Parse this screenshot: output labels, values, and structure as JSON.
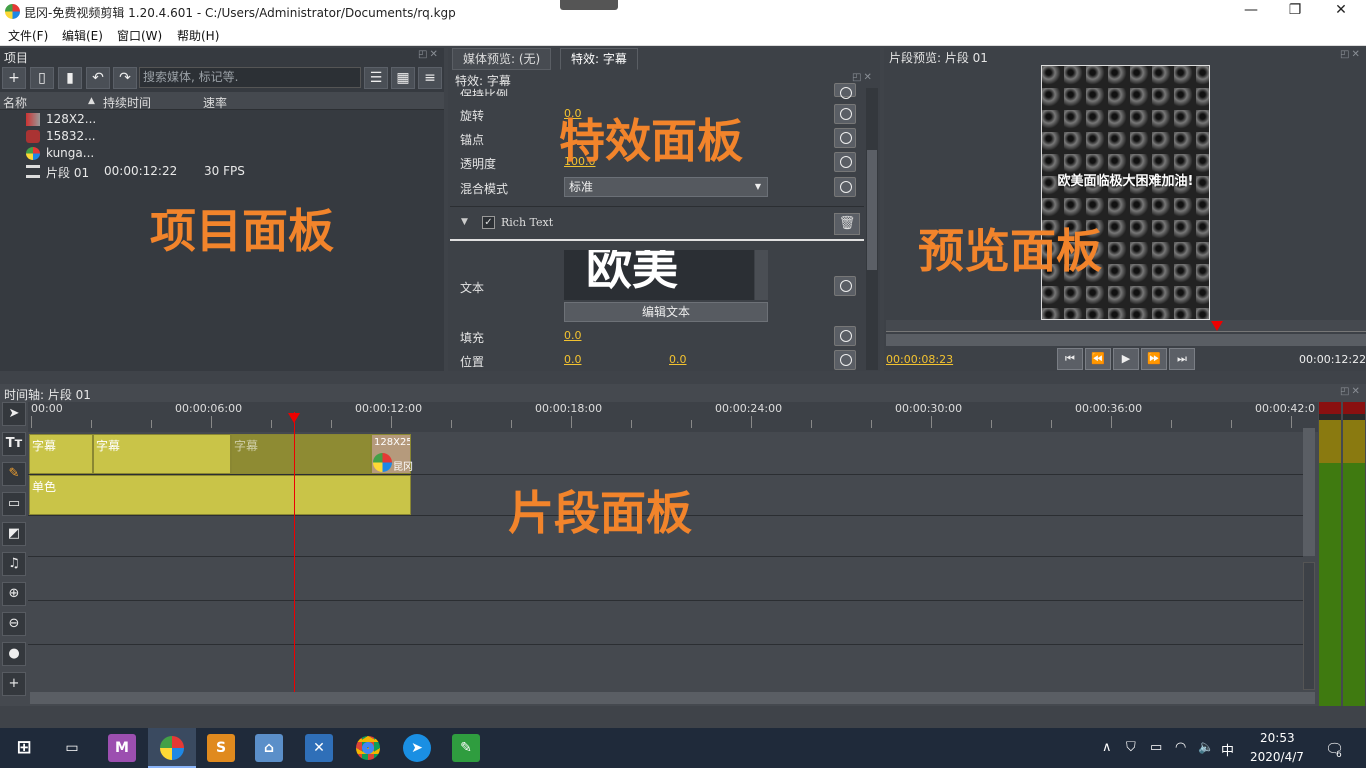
{
  "window": {
    "title": "昆冈-免费视频剪辑 1.20.4.601 - C:/Users/Administrator/Documents/rq.kgp",
    "min": "—",
    "max": "❐",
    "close": "✕"
  },
  "menu": [
    "文件(F)",
    "编辑(E)",
    "窗口(W)",
    "帮助(H)"
  ],
  "project": {
    "title": "项目",
    "search_placeholder": "搜索媒体, 标记等.",
    "columns": [
      "名称",
      "持续时间",
      "速率"
    ],
    "rows": [
      {
        "name": "128X2...",
        "duration": "",
        "rate": ""
      },
      {
        "name": "15832...",
        "duration": "",
        "rate": ""
      },
      {
        "name": "kunga...",
        "duration": "",
        "rate": ""
      },
      {
        "name": "片段 01",
        "duration": "00:00:12:22",
        "rate": "30 FPS"
      }
    ],
    "overlay": "项目面板"
  },
  "fx": {
    "tab_media": "媒体预览: (无)",
    "tab_fx": "特效: 字幕",
    "header": "特效: 字幕",
    "overlay": "特效面板",
    "rows": {
      "keep_ratio": "保持比例",
      "rotate": "旋转",
      "rotate_val": "0.0",
      "anchor": "锚点",
      "opacity": "透明度",
      "opacity_val": "100.0",
      "blend": "混合模式",
      "blend_val": "标准",
      "rich_text": "Rich Text",
      "text": "文本",
      "text_preview": "欧美",
      "edit_text": "编辑文本",
      "fill": "填充",
      "fill_val": "0.0",
      "position": "位置",
      "pos_x": "0.0",
      "pos_y": "0.0"
    }
  },
  "preview": {
    "title": "片段预览: 片段 01",
    "caption": "欧美面临极大困难加油!",
    "overlay": "预览面板",
    "time_current": "00:00:08:23",
    "time_total": "00:00:12:22",
    "playhead_fraction": 0.69
  },
  "timeline": {
    "title": "时间轴: 片段 01",
    "overlay": "片段面板",
    "ticks": [
      "00:00",
      "00:00:06:00",
      "00:00:12:00",
      "00:00:18:00",
      "00:00:24:00",
      "00:00:30:00",
      "00:00:36:00",
      "00:00:42:0"
    ],
    "clips_track1": [
      "字幕",
      "字幕",
      "字幕",
      "128X25"
    ],
    "clip_logo_text": "昆冈",
    "clip_track2": "单色"
  },
  "taskbar": {
    "time": "20:53",
    "date": "2020/4/7",
    "ime": "中",
    "notif_count": "6"
  }
}
